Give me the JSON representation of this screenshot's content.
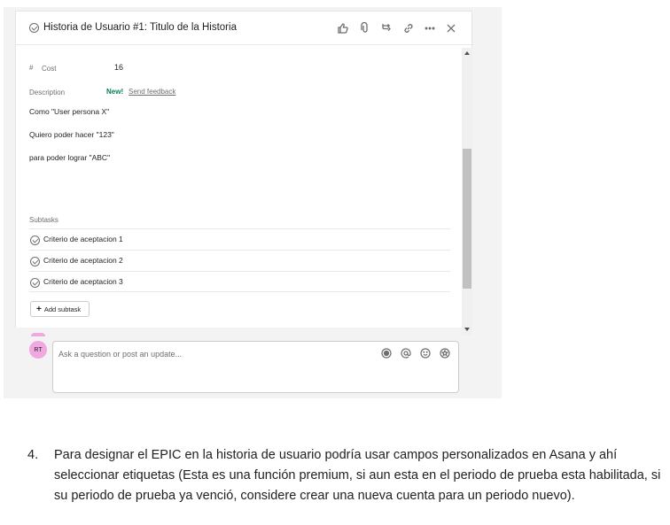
{
  "task": {
    "title": "Historia de Usuario #1: Titulo de la Historia",
    "fields": {
      "cost_label": "Cost",
      "cost_value": "16",
      "description_label": "Description",
      "new_badge": "New!",
      "feedback_link": "Send feedback"
    },
    "description_lines": [
      "Como \"User persona X\"",
      "Quiero poder hacer \"123\"",
      "para poder lograr \"ABC\""
    ],
    "subtasks_label": "Subtasks",
    "subtasks": [
      {
        "label": "Criterio de aceptacion 1"
      },
      {
        "label": "Criterio de aceptacion 2"
      },
      {
        "label": "Criterio de aceptacion 3"
      }
    ],
    "add_subtask_label": "Add subtask",
    "header_icons": [
      "thumbs-up-icon",
      "attachment-icon",
      "subtask-icon",
      "link-icon",
      "more-icon",
      "close-icon"
    ]
  },
  "comment": {
    "avatar_initials": "RT",
    "avatar_color": "#f1a7e0",
    "placeholder": "Ask a question or post an update...",
    "icons": [
      "record-icon",
      "mention-icon",
      "emoji-icon",
      "star-icon"
    ]
  },
  "instruction": {
    "number": "4.",
    "text": "Para designar el EPIC en la historia de usuario podría usar campos personalizados en Asana y ahí seleccionar etiquetas (Esta es una función premium, si aun esta en el periodo de prueba esta habilitada, si su periodo de prueba ya venció, considere crear una nueva cuenta para un periodo nuevo)."
  },
  "colors": {
    "new_badge": "#0d7f56",
    "text": "#1e1f21",
    "muted": "#6d6e6f"
  }
}
